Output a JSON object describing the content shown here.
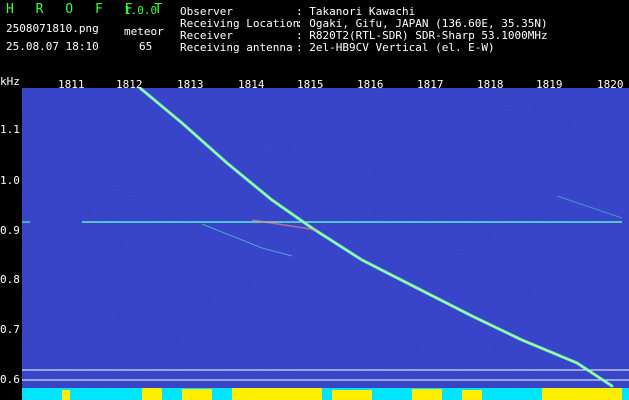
{
  "header": {
    "app_name": "H R O F F T",
    "version": "1.0.0",
    "filename": "2508071810.png",
    "datetime": "25.08.07 18:10",
    "meteor_label": "meteor",
    "meteor_count": "65",
    "info": [
      {
        "label": "Observer",
        "value": ": Takanori Kawachi"
      },
      {
        "label": "Receiving Location",
        "value": ": Ogaki, Gifu, JAPAN (136.60E, 35.35N)"
      },
      {
        "label": "Receiver",
        "value": ": R820T2(RTL-SDR) SDR-Sharp 53.1000MHz"
      },
      {
        "label": "Receiving antenna",
        "value": ": 2el-HB9CV Vertical (el. E-W)"
      }
    ]
  },
  "axes": {
    "y_unit": "kHz",
    "x_ticks": [
      "1811",
      "1812",
      "1813",
      "1814",
      "1815",
      "1816",
      "1817",
      "1818",
      "1819",
      "1820"
    ],
    "y_ticks": [
      "1.1",
      "1.0",
      "0.9",
      "0.8",
      "0.7",
      "0.6"
    ]
  },
  "colors": {
    "background": "#0a0a6e",
    "signal": "#66ffcc",
    "header_text_green": "#3cff3c",
    "header_text_white": "#ffffff",
    "noise_bar": "#00e5ff",
    "noise_bar_peak": "#ffee00"
  }
}
